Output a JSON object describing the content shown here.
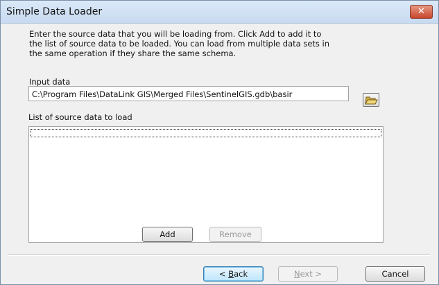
{
  "window": {
    "title": "Simple Data Loader"
  },
  "description": [
    "Enter the source data that you will be loading from. Click Add to add it to",
    "the list of source data to be loaded. You can load from multiple data sets in",
    "the same operation if they share the same schema."
  ],
  "input": {
    "label": "Input data",
    "value": "C:\\Program Files\\DataLink GIS\\Merged Files\\SentinelGIS.gdb\\basir",
    "browse_icon": "folder-open-icon"
  },
  "list": {
    "label": "List of source data to load",
    "items": []
  },
  "buttons": {
    "add": "Add",
    "remove": "Remove",
    "back_mnemonic": "B",
    "back_rest": "ack",
    "back_prefix": "< ",
    "next_mnemonic": "N",
    "next_rest": "ext >",
    "cancel": "Cancel"
  },
  "close_glyph": "✕"
}
